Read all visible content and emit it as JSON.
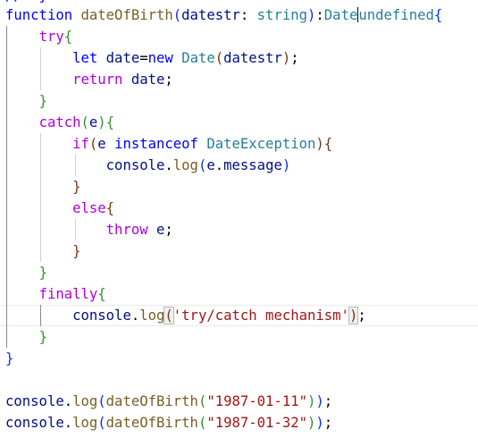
{
  "code_lines": [
    [
      {
        "t": "function",
        "c": "kw"
      },
      {
        "t": " ",
        "c": ""
      },
      {
        "t": "dateOfBirth",
        "c": "fn"
      },
      {
        "t": "(",
        "c": "b1"
      },
      {
        "t": "datestr",
        "c": "var"
      },
      {
        "t": ": ",
        "c": ""
      },
      {
        "t": "string",
        "c": "ty"
      },
      {
        "t": ")",
        "c": "b1"
      },
      {
        "t": ":",
        "c": ""
      },
      {
        "t": "Date",
        "c": "ty"
      },
      {
        "cursor": true
      },
      {
        "t": "undefined",
        "c": "ty"
      },
      {
        "t": "{",
        "c": "b1"
      }
    ],
    [
      {
        "t": "    ",
        "c": ""
      },
      {
        "t": "try",
        "c": "ctl"
      },
      {
        "t": "{",
        "c": "b2"
      }
    ],
    [
      {
        "t": "        ",
        "c": ""
      },
      {
        "t": "let",
        "c": "kw"
      },
      {
        "t": " ",
        "c": ""
      },
      {
        "t": "date",
        "c": "var"
      },
      {
        "t": "=",
        "c": ""
      },
      {
        "t": "new",
        "c": "kw"
      },
      {
        "t": " ",
        "c": ""
      },
      {
        "t": "Date",
        "c": "ty"
      },
      {
        "t": "(",
        "c": "b3"
      },
      {
        "t": "datestr",
        "c": "var"
      },
      {
        "t": ")",
        "c": "b3"
      },
      {
        "t": ";",
        "c": ""
      }
    ],
    [
      {
        "t": "        ",
        "c": ""
      },
      {
        "t": "return",
        "c": "ctl"
      },
      {
        "t": " ",
        "c": ""
      },
      {
        "t": "date",
        "c": "var"
      },
      {
        "t": ";",
        "c": ""
      }
    ],
    [
      {
        "t": "    ",
        "c": ""
      },
      {
        "t": "}",
        "c": "b2"
      }
    ],
    [
      {
        "t": "    ",
        "c": ""
      },
      {
        "t": "catch",
        "c": "ctl"
      },
      {
        "t": "(",
        "c": "b2"
      },
      {
        "t": "e",
        "c": "var"
      },
      {
        "t": ")",
        "c": "b2"
      },
      {
        "t": "{",
        "c": "b2"
      }
    ],
    [
      {
        "t": "        ",
        "c": ""
      },
      {
        "t": "if",
        "c": "ctl"
      },
      {
        "t": "(",
        "c": "b3"
      },
      {
        "t": "e",
        "c": "var"
      },
      {
        "t": " ",
        "c": ""
      },
      {
        "t": "instanceof",
        "c": "kw"
      },
      {
        "t": " ",
        "c": ""
      },
      {
        "t": "DateException",
        "c": "ty"
      },
      {
        "t": ")",
        "c": "b3"
      },
      {
        "t": "{",
        "c": "b3"
      }
    ],
    [
      {
        "t": "            ",
        "c": ""
      },
      {
        "t": "console",
        "c": "var"
      },
      {
        "t": ".",
        "c": ""
      },
      {
        "t": "log",
        "c": "fn"
      },
      {
        "t": "(",
        "c": "b1"
      },
      {
        "t": "e",
        "c": "var"
      },
      {
        "t": ".",
        "c": ""
      },
      {
        "t": "message",
        "c": "var"
      },
      {
        "t": ")",
        "c": "b1"
      }
    ],
    [
      {
        "t": "        ",
        "c": ""
      },
      {
        "t": "}",
        "c": "b3"
      }
    ],
    [
      {
        "t": "        ",
        "c": ""
      },
      {
        "t": "else",
        "c": "ctl"
      },
      {
        "t": "{",
        "c": "b3"
      }
    ],
    [
      {
        "t": "            ",
        "c": ""
      },
      {
        "t": "throw",
        "c": "ctl"
      },
      {
        "t": " ",
        "c": ""
      },
      {
        "t": "e",
        "c": "var"
      },
      {
        "t": ";",
        "c": ""
      }
    ],
    [
      {
        "t": "        ",
        "c": ""
      },
      {
        "t": "}",
        "c": "b3"
      }
    ],
    [
      {
        "t": "    ",
        "c": ""
      },
      {
        "t": "}",
        "c": "b2"
      }
    ],
    [
      {
        "t": "    ",
        "c": ""
      },
      {
        "t": "finally",
        "c": "ctl"
      },
      {
        "t": "{",
        "c": "b2"
      }
    ],
    [
      {
        "t": "        ",
        "c": ""
      },
      {
        "t": "console",
        "c": "var"
      },
      {
        "t": ".",
        "c": ""
      },
      {
        "t": "log",
        "c": "fn"
      },
      {
        "t": "(",
        "c": "b3 bm"
      },
      {
        "t": "'try/catch mechanism'",
        "c": "str"
      },
      {
        "t": ")",
        "c": "b3 bm"
      },
      {
        "t": ";",
        "c": ""
      }
    ],
    [
      {
        "t": "    ",
        "c": ""
      },
      {
        "t": "}",
        "c": "b2"
      }
    ],
    [
      {
        "t": "}",
        "c": "b1"
      }
    ],
    [],
    [
      {
        "t": "console",
        "c": "var"
      },
      {
        "t": ".",
        "c": ""
      },
      {
        "t": "log",
        "c": "fn"
      },
      {
        "t": "(",
        "c": "b1"
      },
      {
        "t": "dateOfBirth",
        "c": "fn"
      },
      {
        "t": "(",
        "c": "b2"
      },
      {
        "t": "\"1987-01-11\"",
        "c": "str"
      },
      {
        "t": ")",
        "c": "b2"
      },
      {
        "t": ")",
        "c": "b1"
      },
      {
        "t": ";",
        "c": ""
      }
    ],
    [
      {
        "t": "console",
        "c": "var"
      },
      {
        "t": ".",
        "c": ""
      },
      {
        "t": "log",
        "c": "fn"
      },
      {
        "t": "(",
        "c": "b1"
      },
      {
        "t": "dateOfBirth",
        "c": "fn"
      },
      {
        "t": "(",
        "c": "b2"
      },
      {
        "t": "\"1987-01-32\"",
        "c": "str"
      },
      {
        "t": ")",
        "c": "b2"
      },
      {
        "t": ")",
        "c": "b1"
      },
      {
        "t": ";",
        "c": ""
      }
    ]
  ],
  "current_line": 14
}
